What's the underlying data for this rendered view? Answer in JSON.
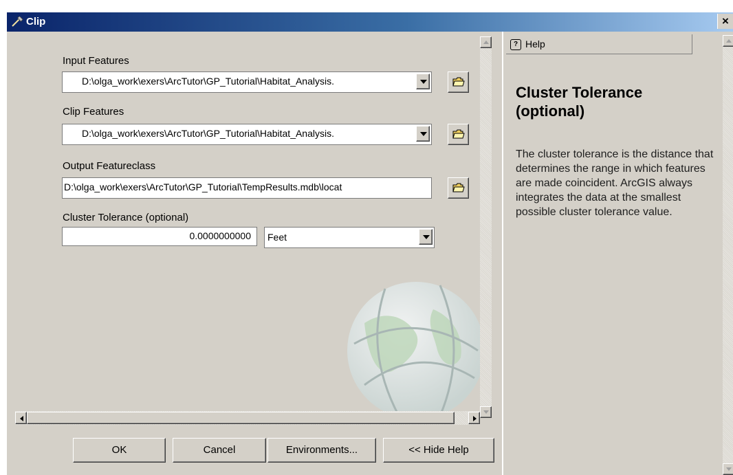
{
  "window": {
    "title": "Clip",
    "close_label": "×"
  },
  "form": {
    "input_features": {
      "label": "Input Features",
      "value": "D:\\olga_work\\exers\\ArcTutor\\GP_Tutorial\\Habitat_Analysis."
    },
    "clip_features": {
      "label": "Clip Features",
      "value": "D:\\olga_work\\exers\\ArcTutor\\GP_Tutorial\\Habitat_Analysis."
    },
    "output_featureclass": {
      "label": "Output Featureclass",
      "value": "D:\\olga_work\\exers\\ArcTutor\\GP_Tutorial\\TempResults.mdb\\locat"
    },
    "cluster_tolerance": {
      "label": "Cluster Tolerance (optional)",
      "value": "0.0000000000",
      "unit": "Feet"
    }
  },
  "buttons": {
    "ok": "OK",
    "cancel": "Cancel",
    "environments": "Environments...",
    "hide_help": "<< Hide Help"
  },
  "help": {
    "tab_label": "Help",
    "heading": "Cluster Tolerance (optional)",
    "body": "The cluster tolerance is the distance that determines the range in which features are made coincident. ArcGIS always integrates the data at the smallest possible cluster tolerance value."
  },
  "icons": {
    "title": "hammer-icon",
    "browse": "open-folder-icon",
    "dropdown": "down-arrow-icon",
    "background": "globe-watermark"
  },
  "colors": {
    "title_bar_start": "#0a246a",
    "title_bar_end": "#a6caf0",
    "dialog_face": "#d4d0c8"
  }
}
